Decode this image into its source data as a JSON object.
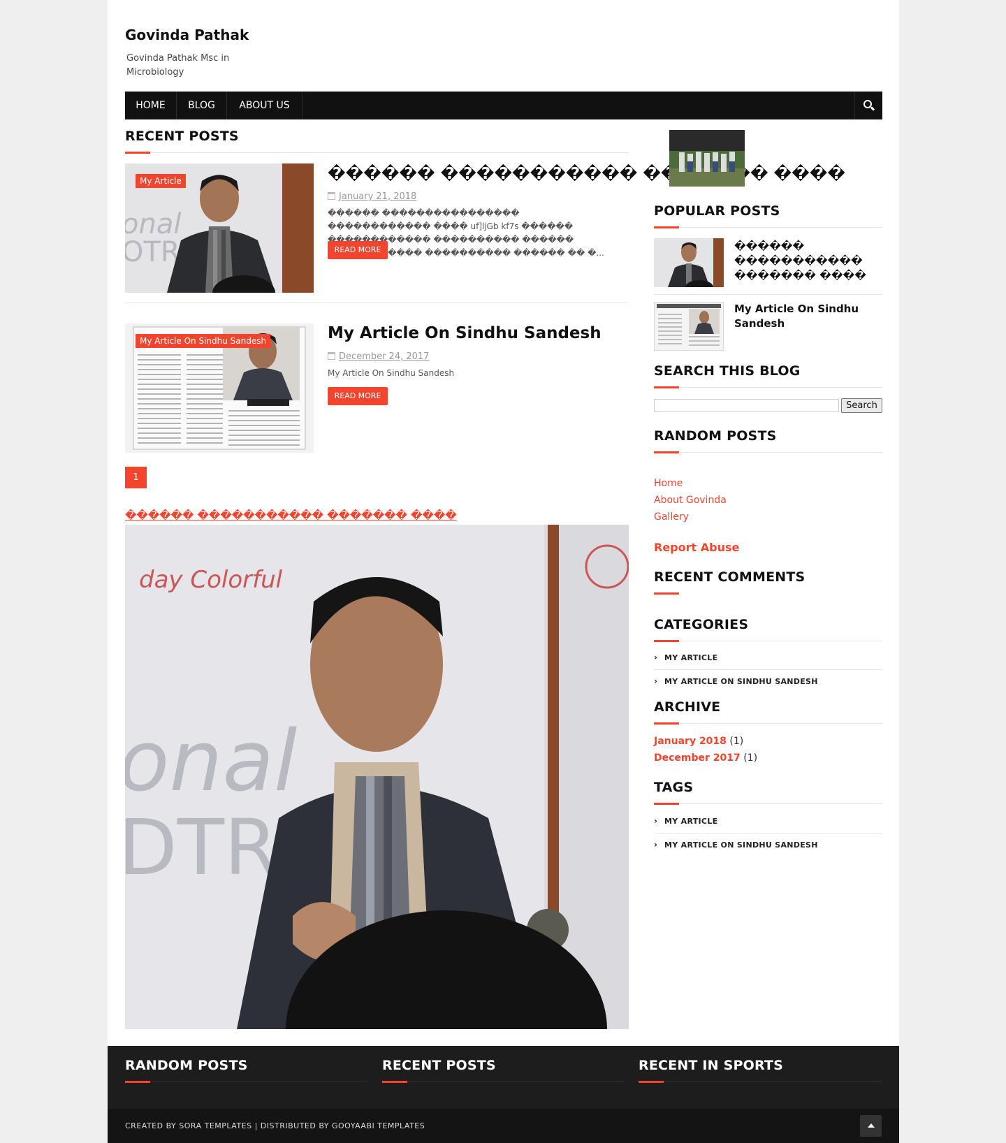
{
  "site": {
    "title": "Govinda Pathak",
    "description": "Govinda Pathak Msc in Microbiology"
  },
  "nav": {
    "items": [
      {
        "label": "HOME"
      },
      {
        "label": "BLOG"
      },
      {
        "label": "ABOUT US"
      }
    ],
    "search_icon": "search-icon"
  },
  "main": {
    "section_title": "RECENT POSTS",
    "posts": [
      {
        "label": "My Article",
        "title": "������ ����������� ������� ����",
        "date": "January 21, 2018",
        "snippet": "������ ���������������� ������������ ���� uf]ljGb kf7s ������ ������������ ���������� ������ ����������� ���������� ������ �� �...",
        "read_more": "READ MORE"
      },
      {
        "label": "My Article On Sindhu Sandesh",
        "title": "My Article On Sindhu Sandesh",
        "date": "December 24, 2017",
        "snippet": "My Article On Sindhu Sandesh",
        "read_more": "READ MORE"
      }
    ],
    "page_number": "1",
    "feature_title": "������ ����������� ������� ����"
  },
  "sidebar": {
    "popular_title": "POPULAR POSTS",
    "popular": [
      {
        "title": "������ ����������� ������� ����"
      },
      {
        "title": "My Article On Sindhu Sandesh"
      }
    ],
    "search_title": "SEARCH THIS BLOG",
    "search_button": "Search",
    "random_title": "RANDOM POSTS",
    "links": [
      "Home",
      "About Govinda",
      "Gallery"
    ],
    "report_abuse": "Report Abuse",
    "recent_comments_title": "RECENT COMMENTS",
    "categories_title": "CATEGORIES",
    "categories": [
      "MY ARTICLE",
      "MY ARTICLE ON SINDHU SANDESH"
    ],
    "archive_title": "ARCHIVE",
    "archive": [
      {
        "label": "January 2018",
        "count": "(1)"
      },
      {
        "label": "December 2017",
        "count": "(1)"
      }
    ],
    "tags_title": "TAGS",
    "tags": [
      "MY ARTICLE",
      "MY ARTICLE ON SINDHU SANDESH"
    ]
  },
  "footer": {
    "col1_title": "RANDOM POSTS",
    "col2_title": "RECENT POSTS",
    "col3_title": "RECENT IN SPORTS",
    "credits": "CREATED BY SORA TEMPLATES | DISTRIBUTED BY GOOYAABI TEMPLATES"
  },
  "colors": {
    "accent": "#f4442e",
    "nav_bg": "#111111",
    "footer_bg": "#1d1d1d"
  }
}
